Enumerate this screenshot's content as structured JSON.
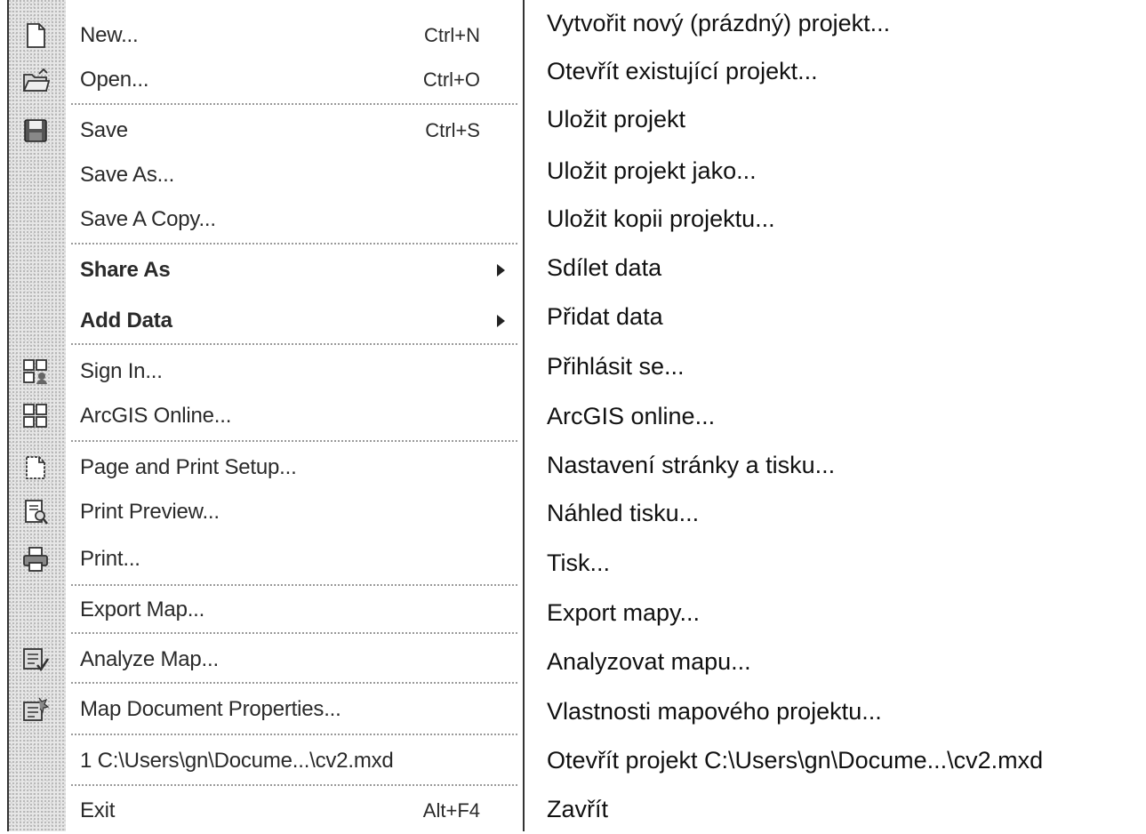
{
  "menu": {
    "items": [
      {
        "label": "New...",
        "shortcut": "Ctrl+N",
        "icon": "new-document-icon"
      },
      {
        "label": "Open...",
        "shortcut": "Ctrl+O",
        "icon": "open-folder-icon"
      },
      {
        "label": "Save",
        "shortcut": "Ctrl+S",
        "icon": "save-disk-icon"
      },
      {
        "label": "Save As...",
        "shortcut": "",
        "icon": ""
      },
      {
        "label": "Save A Copy...",
        "shortcut": "",
        "icon": ""
      },
      {
        "label": "Share As",
        "shortcut": "",
        "icon": "",
        "submenu": true
      },
      {
        "label": "Add Data",
        "shortcut": "",
        "icon": "",
        "submenu": true
      },
      {
        "label": "Sign In...",
        "shortcut": "",
        "icon": "sign-in-icon"
      },
      {
        "label": "ArcGIS Online...",
        "shortcut": "",
        "icon": "arcgis-online-icon"
      },
      {
        "label": "Page and Print Setup...",
        "shortcut": "",
        "icon": "page-setup-icon"
      },
      {
        "label": "Print Preview...",
        "shortcut": "",
        "icon": "print-preview-icon"
      },
      {
        "label": "Print...",
        "shortcut": "",
        "icon": "printer-icon"
      },
      {
        "label": "Export Map...",
        "shortcut": "",
        "icon": ""
      },
      {
        "label": "Analyze Map...",
        "shortcut": "",
        "icon": "analyze-map-icon"
      },
      {
        "label": "Map Document Properties...",
        "shortcut": "",
        "icon": "document-properties-icon"
      },
      {
        "label": "1 C:\\Users\\gn\\Docume...\\cv2.mxd",
        "shortcut": "",
        "icon": ""
      },
      {
        "label": "Exit",
        "shortcut": "Alt+F4",
        "icon": ""
      }
    ]
  },
  "translations": [
    "Vytvořit nový (prázdný) projekt...",
    "Otevřít existující projekt...",
    "Uložit projekt",
    "Uložit projekt jako...",
    "Uložit kopii projektu...",
    "Sdílet data",
    "Přidat data",
    "Přihlásit se...",
    "ArcGIS online...",
    "Nastavení stránky a tisku...",
    "Náhled tisku...",
    "Tisk...",
    "Export mapy...",
    "Analyzovat mapu...",
    "Vlastnosti mapového projektu...",
    "Otevřít projekt C:\\Users\\gn\\Docume...\\cv2.mxd",
    "Zavřít"
  ]
}
